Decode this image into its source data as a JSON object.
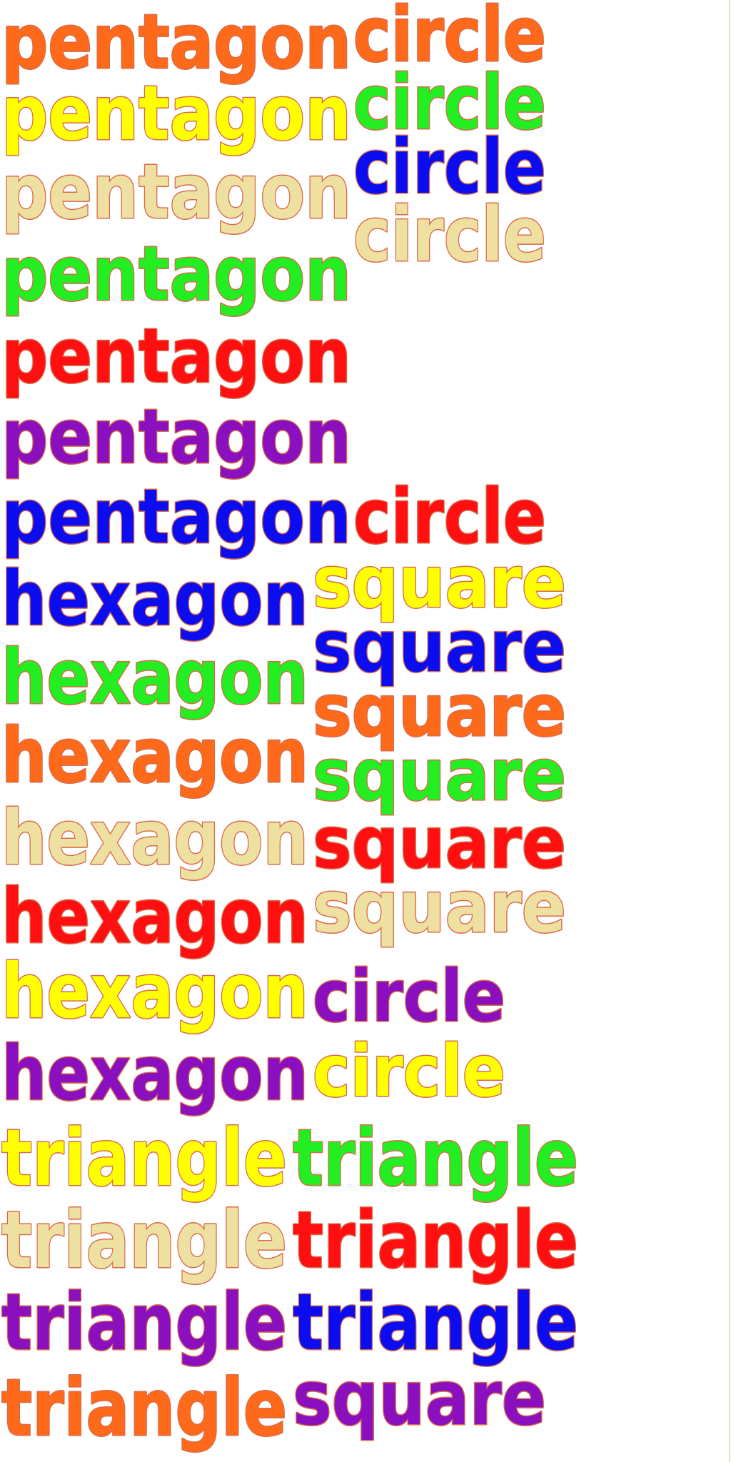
{
  "colors": {
    "orange": "#ff6a1a",
    "yellow": "#ffff00",
    "beige": "#eee0a0",
    "green": "#22ee22",
    "red": "#ff0f0f",
    "purple": "#8a0fbe",
    "blue": "#0c0cf0",
    "outline": "#d86a4a"
  },
  "rows": [
    {
      "words": [
        {
          "text": "pentagon",
          "color": "orange"
        },
        {
          "text": "circle",
          "color": "orange"
        }
      ]
    },
    {
      "words": [
        {
          "text": "pentagon",
          "color": "yellow"
        },
        {
          "text": "circle",
          "color": "green"
        }
      ]
    },
    {
      "words": [
        {
          "text": "pentagon",
          "color": "beige"
        },
        {
          "text": "circle",
          "color": "blue"
        }
      ]
    },
    {
      "words": [
        {
          "text": "pentagon",
          "color": "green"
        },
        {
          "text": "circle",
          "color": "beige"
        }
      ]
    },
    {
      "words": [
        {
          "text": "pentagon",
          "color": "red"
        }
      ]
    },
    {
      "words": [
        {
          "text": "pentagon",
          "color": "purple"
        }
      ]
    },
    {
      "words": [
        {
          "text": "pentagon",
          "color": "blue"
        },
        {
          "text": "circle",
          "color": "red"
        }
      ]
    },
    {
      "words": [
        {
          "text": "hexagon",
          "color": "blue"
        },
        {
          "text": "square",
          "color": "yellow"
        }
      ]
    },
    {
      "words": [
        {
          "text": "hexagon",
          "color": "green"
        },
        {
          "text": "square",
          "color": "blue"
        }
      ]
    },
    {
      "words": [
        {
          "text": "hexagon",
          "color": "orange"
        },
        {
          "text": "square",
          "color": "orange"
        }
      ]
    },
    {
      "words": [
        {
          "text": "hexagon",
          "color": "beige"
        },
        {
          "text": "square",
          "color": "green"
        }
      ]
    },
    {
      "words": [
        {
          "text": "hexagon",
          "color": "red"
        },
        {
          "text": "square",
          "color": "red"
        }
      ]
    },
    {
      "words": [
        {
          "text": "hexagon",
          "color": "yellow"
        },
        {
          "text": "square",
          "color": "beige"
        }
      ]
    },
    {
      "words": [
        {
          "text": "hexagon",
          "color": "purple"
        },
        {
          "text": "circle",
          "color": "purple"
        }
      ]
    },
    {
      "words": [
        {
          "text": "triangle",
          "color": "yellow"
        },
        {
          "text": "circle",
          "color": "yellow"
        }
      ]
    },
    {
      "words": [
        {
          "text": "triangle",
          "color": "beige"
        },
        {
          "text": "triangle",
          "color": "green"
        }
      ]
    },
    {
      "words": [
        {
          "text": "triangle",
          "color": "purple"
        },
        {
          "text": "triangle",
          "color": "red"
        }
      ]
    },
    {
      "words": [
        {
          "text": "triangle",
          "color": "orange"
        },
        {
          "text": "triangle",
          "color": "blue"
        }
      ]
    },
    {
      "words": [
        {
          "text": "square",
          "color": "purple"
        }
      ]
    }
  ]
}
